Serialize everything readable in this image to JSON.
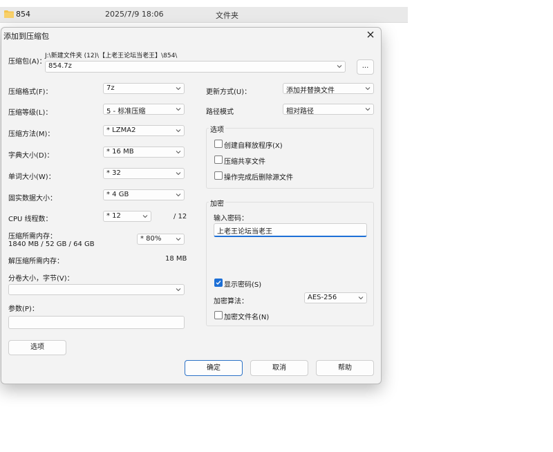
{
  "explorer": {
    "name": "854",
    "date": "2025/7/9 18:06",
    "type": "文件夹"
  },
  "dialog": {
    "title": "添加到压缩包",
    "archive_label": "压缩包(A)：",
    "archive_path": "J:\\新建文件夹 (12)\\【上老王论坛当老王】\\854\\",
    "archive_name": "854.7z",
    "browse_label": "...",
    "format_label": "压缩格式(F)：",
    "format_value": "7z",
    "level_label": "压缩等级(L)：",
    "level_value": "5 - 标准压缩",
    "method_label": "压缩方法(M)：",
    "method_value": "* LZMA2",
    "dict_label": "字典大小(D)：",
    "dict_value": "* 16 MB",
    "word_label": "单词大小(W)：",
    "word_value": "* 32",
    "solid_label": "固实数据大小：",
    "solid_value": "* 4 GB",
    "threads_label": "CPU 线程数：",
    "threads_value": "* 12",
    "threads_total": "/ 12",
    "mem_label": "压缩所需内存：",
    "mem_detail": "1840 MB / 52 GB / 64 GB",
    "mem_value": "* 80%",
    "decomp_label": "解压缩所需内存：",
    "decomp_value": "18 MB",
    "volume_label": "分卷大小，字节(V)：",
    "volume_value": "",
    "params_label": "参数(P)：",
    "params_value": "",
    "options_btn": "选项",
    "update_label": "更新方式(U)：",
    "update_value": "添加并替换文件",
    "path_label": "路径模式",
    "path_value": "相对路径",
    "options_group": "选项",
    "opt_sfx": "创建自释放程序(X)",
    "opt_shared": "压缩共享文件",
    "opt_delete": "操作完成后删除源文件",
    "encrypt_group": "加密",
    "pwd_label": "输入密码：",
    "pwd_value": "上老王论坛当老王",
    "show_pwd": "显示密码(S)",
    "enc_method_label": "加密算法：",
    "enc_method_value": "AES-256",
    "enc_names": "加密文件名(N)",
    "ok": "确定",
    "cancel": "取消",
    "help": "帮助"
  },
  "colors": {
    "accent": "#1c6fd6",
    "folder": "#f4c34b",
    "dialog_bg": "#f3f3f3"
  },
  "icons": [
    "folder-icon",
    "close-icon",
    "chevron-down-icon",
    "checkmark-icon"
  ]
}
